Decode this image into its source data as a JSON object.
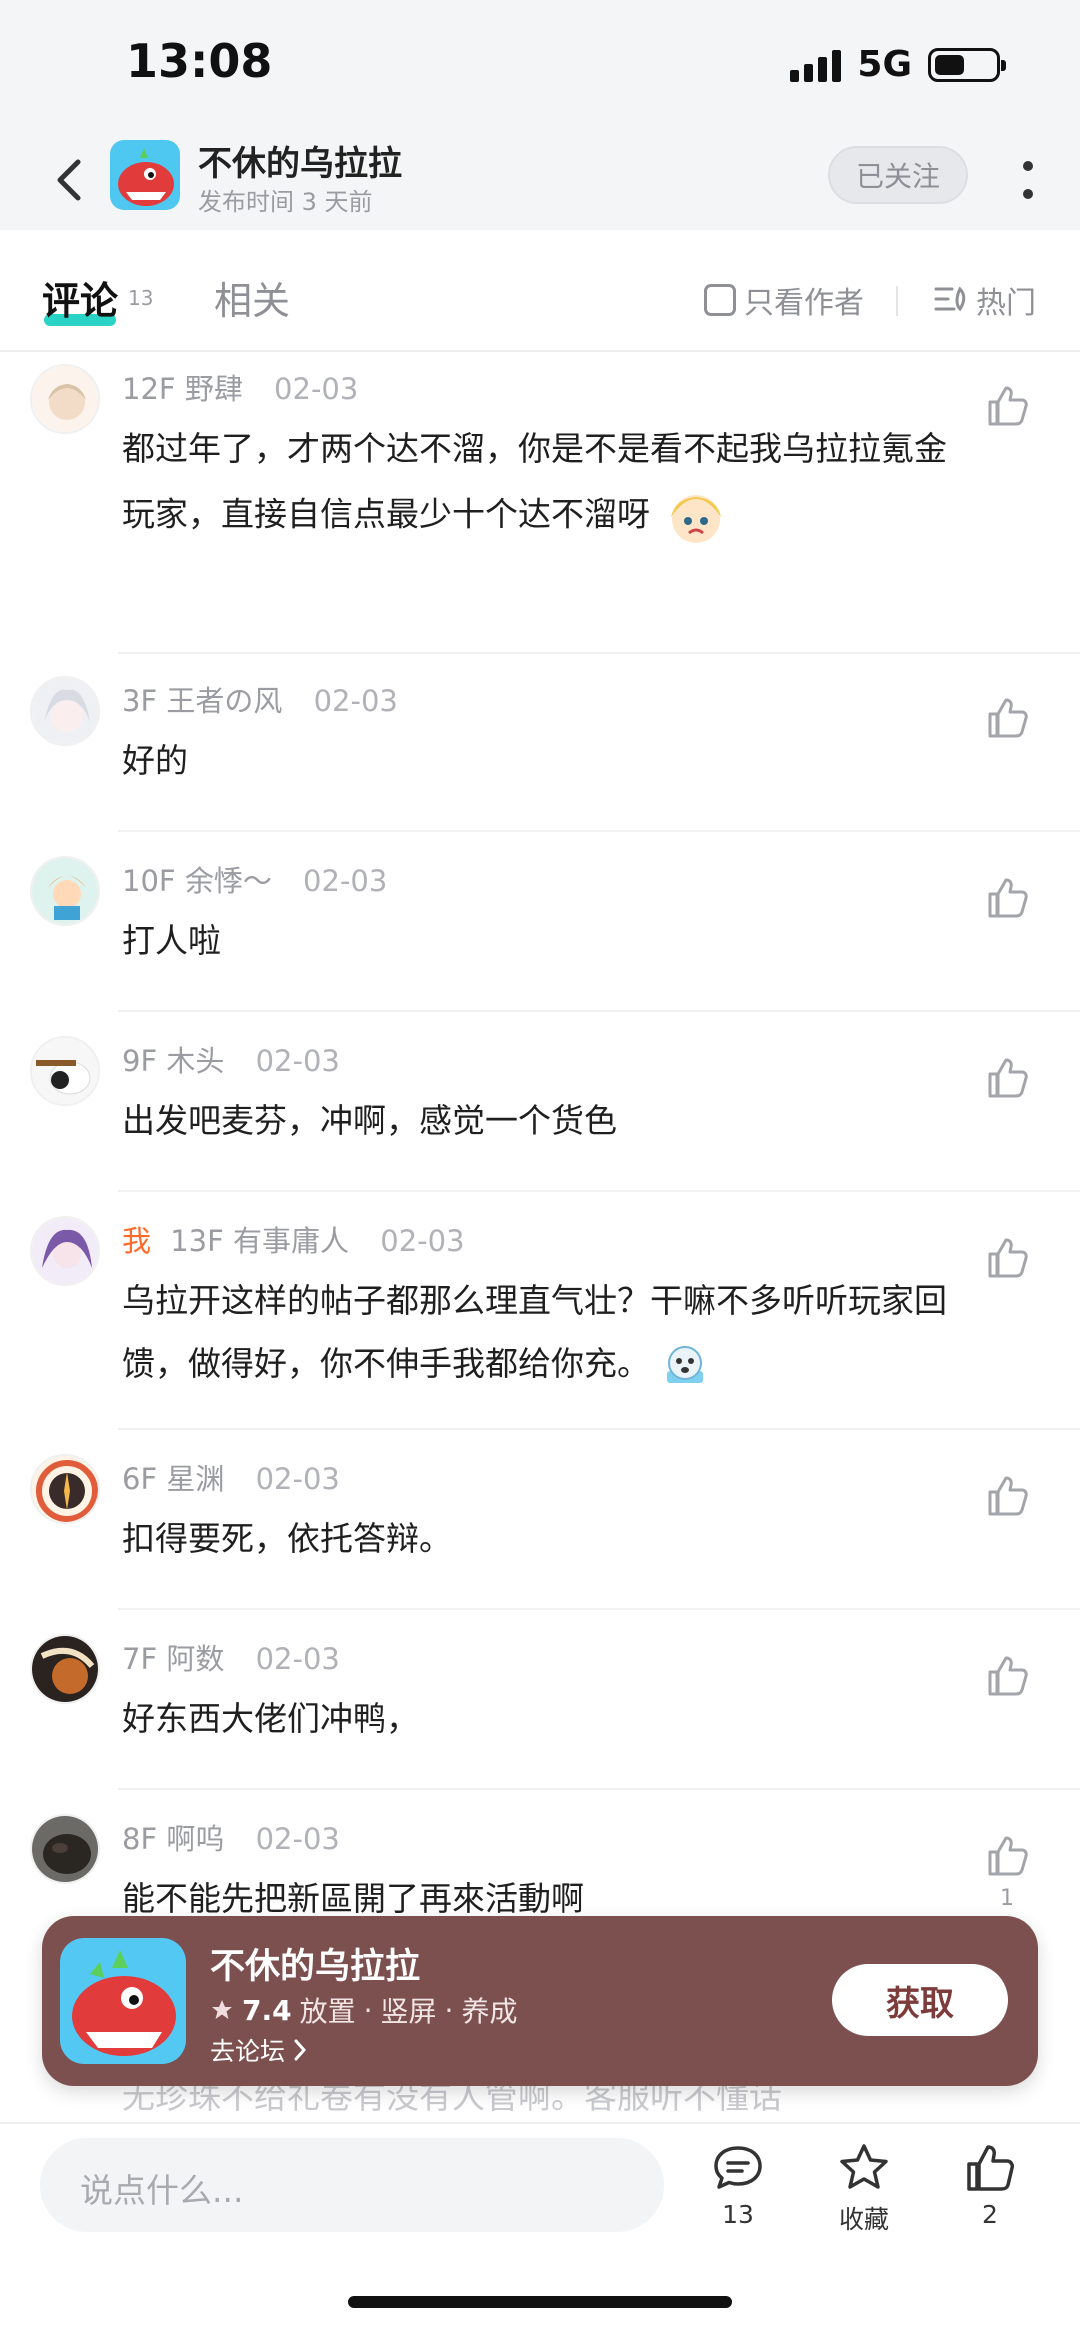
{
  "status_bar": {
    "time": "13:08",
    "network": "5G",
    "battery_level": 0.5
  },
  "header": {
    "title": "不休的乌拉拉",
    "subtitle": "发布时间 3 天前",
    "follow_label": "已关注"
  },
  "tabs": {
    "comments_label": "评论",
    "comments_count": "13",
    "related_label": "相关",
    "author_only_label": "只看作者",
    "sort_label": "热门"
  },
  "comments": [
    {
      "me": "",
      "floor": "12F",
      "user": "野肆",
      "date": "02-03",
      "text": "都过年了，才两个达不溜，你是不是看不起我乌拉拉氪金玩家，直接自信点最少十个达不溜呀",
      "likes": ""
    },
    {
      "me": "",
      "floor": "3F",
      "user": "王者の风",
      "date": "02-03",
      "text": "好的",
      "likes": ""
    },
    {
      "me": "",
      "floor": "10F",
      "user": "余悸～",
      "date": "02-03",
      "text": "打人啦",
      "likes": ""
    },
    {
      "me": "",
      "floor": "9F",
      "user": "木头",
      "date": "02-03",
      "text": "出发吧麦芬，冲啊，感觉一个货色",
      "likes": ""
    },
    {
      "me": "我",
      "floor": "13F",
      "user": "有事庸人",
      "date": "02-03",
      "text": "乌拉开这样的帖子都那么理直气壮？干嘛不多听听玩家回馈，做得好，你不伸手我都给你充。",
      "likes": ""
    },
    {
      "me": "",
      "floor": "6F",
      "user": "星渊",
      "date": "02-03",
      "text": "扣得要死，依托答辩。",
      "likes": ""
    },
    {
      "me": "",
      "floor": "7F",
      "user": "阿数",
      "date": "02-03",
      "text": "好东西大佬们冲鸭，",
      "likes": ""
    },
    {
      "me": "",
      "floor": "8F",
      "user": "啊呜",
      "date": "02-03",
      "text": "能不能先把新區開了再來活動啊",
      "likes": "1"
    }
  ],
  "peek_comment": "无珍珠不给礼卷有没有人管啊。客服听不懂话",
  "promo": {
    "name": "不休的乌拉拉",
    "rating": "7.4",
    "tags": [
      "放置",
      "竖屏",
      "养成"
    ],
    "forum_link": "去论坛",
    "get_label": "获取"
  },
  "bottom_bar": {
    "input_placeholder": "说点什么...",
    "comment_count": "13",
    "favorite_label": "收藏",
    "like_count": "2"
  },
  "colors": {
    "accent": "#29d3c6",
    "promo_bg": "#7d5050",
    "me_tag": "#ff6a2b"
  }
}
